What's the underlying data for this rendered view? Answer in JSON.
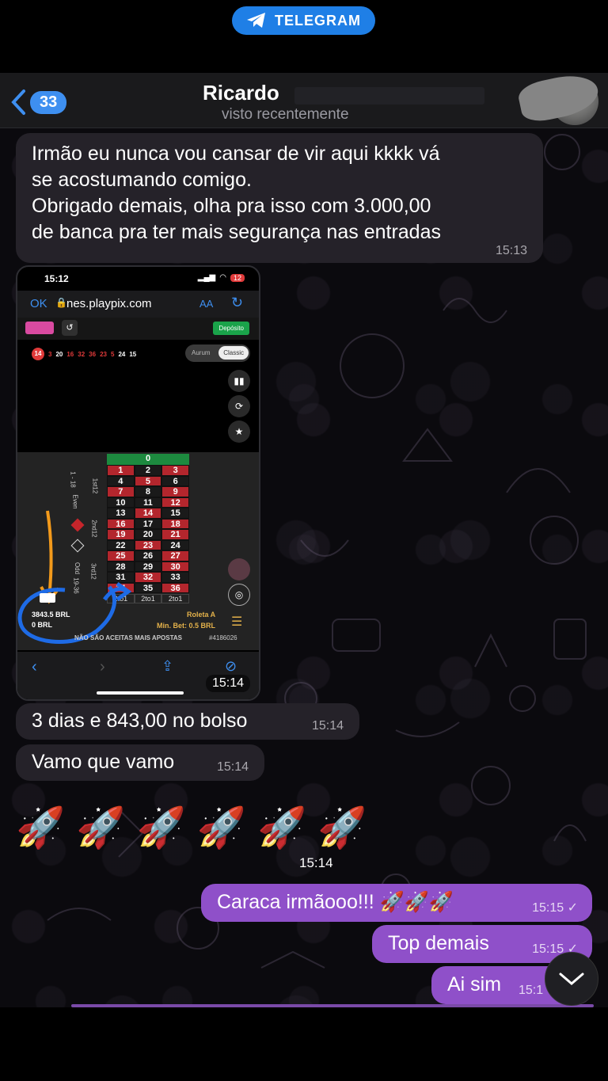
{
  "banner": {
    "label": "TELEGRAM"
  },
  "header": {
    "back_count": "33",
    "contact_name": "Ricardo",
    "status": "visto recentemente"
  },
  "messages": [
    {
      "text": "Irmão eu nunca vou cansar de vir aqui kkkk vá se acostumando comigo.\nObrigado demais, olha pra isso com 3.000,00 de banca pra ter mais segurança nas entradas",
      "lines": [
        "Irmão eu nunca vou cansar de vir aqui kkkk vá",
        "se acostumando comigo.",
        "Obrigado demais, olha pra isso com 3.000,00",
        "de banca pra ter mais segurança nas entradas"
      ],
      "time": "15:13"
    },
    {
      "text": "3 dias e 843,00 no bolso",
      "time": "15:14"
    },
    {
      "text": "Vamo que vamo",
      "time": "15:14"
    },
    {
      "text": "🚀🚀🚀🚀🚀🚀",
      "time": "15:14"
    },
    {
      "text": "Caraca irmãooo!!! 🚀🚀🚀",
      "time": "15:15"
    },
    {
      "text": "Top demais",
      "time": "15:15"
    },
    {
      "text": "Ai sim",
      "time": "15:1"
    }
  ],
  "screenshot": {
    "clock": "15:12",
    "battery": "12",
    "ok": "OK",
    "url": "nes.playpix.com",
    "aa": "AA",
    "deposit": "Depósito",
    "recent_numbers": [
      "14",
      "3",
      "20",
      "16",
      "32",
      "36",
      "23",
      "5",
      "24",
      "15"
    ],
    "mode_aurum": "Aurum",
    "mode_classic": "Classic",
    "zero": "0",
    "grid": [
      [
        "1",
        "2",
        "3"
      ],
      [
        "4",
        "5",
        "6"
      ],
      [
        "7",
        "8",
        "9"
      ],
      [
        "10",
        "11",
        "12"
      ],
      [
        "13",
        "14",
        "15"
      ],
      [
        "16",
        "17",
        "18"
      ],
      [
        "19",
        "20",
        "21"
      ],
      [
        "22",
        "23",
        "24"
      ],
      [
        "25",
        "26",
        "27"
      ],
      [
        "28",
        "29",
        "30"
      ],
      [
        "31",
        "32",
        "33"
      ],
      [
        "34",
        "35",
        "36"
      ]
    ],
    "columns": [
      "2to1",
      "2to1",
      "2to1"
    ],
    "rail_top": "1 - 18",
    "rail_even": "Even",
    "rail_odd": "Odd",
    "rail_19": "19-36",
    "dozen1": "1st12",
    "dozen2": "2nd12",
    "dozen3": "3rd12",
    "balance": "3843.5 BRL",
    "bet": "0 BRL",
    "table_name": "Roleta A",
    "min_bet": "Min. Bet: 0.5 BRL",
    "no_bets": "NÃO SÃO ACEITAS MAIS APOSTAS",
    "game_id": "#4186026",
    "sent_time": "15:14"
  },
  "colors": {
    "accent_blue": "#3e8ff0",
    "outgoing_bubble": "#8f50c9",
    "incoming_bubble": "#252229"
  },
  "icons": [
    "telegram-plane-icon",
    "chevron-left-icon",
    "rocket-emoji-icon",
    "chevron-down-icon",
    "double-check-icon"
  ]
}
